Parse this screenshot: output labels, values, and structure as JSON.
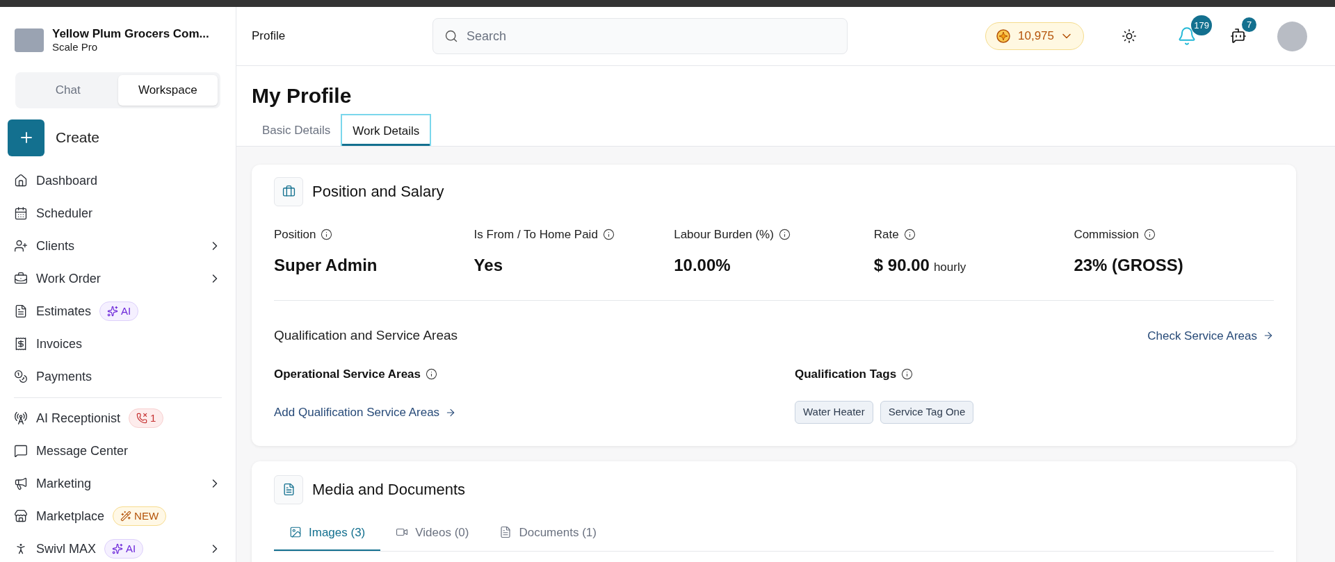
{
  "sidebar": {
    "company": {
      "name": "Yellow Plum Grocers Com...",
      "plan": "Scale Pro"
    },
    "mode_tabs": [
      {
        "label": "Chat",
        "selected": false
      },
      {
        "label": "Workspace",
        "selected": true
      }
    ],
    "create": {
      "label": "Create"
    },
    "sections": [
      {
        "items": [
          {
            "label": "Dashboard",
            "expandable": false
          },
          {
            "label": "Scheduler",
            "expandable": false
          },
          {
            "label": "Clients",
            "expandable": true
          },
          {
            "label": "Work Order",
            "expandable": true
          },
          {
            "label": "Estimates",
            "expandable": false,
            "badge": {
              "kind": "ai",
              "text": "AI"
            }
          },
          {
            "label": "Invoices",
            "expandable": false
          },
          {
            "label": "Payments",
            "expandable": false
          }
        ]
      },
      {
        "items": [
          {
            "label": "AI Receptionist",
            "expandable": false,
            "badge": {
              "kind": "missed",
              "text": "1"
            }
          },
          {
            "label": "Message Center",
            "expandable": false
          },
          {
            "label": "Marketing",
            "expandable": true
          },
          {
            "label": "Marketplace",
            "expandable": false,
            "badge": {
              "kind": "new",
              "text": "NEW"
            }
          },
          {
            "label": "Swivl MAX",
            "expandable": true,
            "badge": {
              "kind": "ai",
              "text": "AI"
            }
          }
        ]
      }
    ]
  },
  "header": {
    "breadcrumb": "Profile",
    "search": {
      "placeholder": "Search"
    },
    "coins": "10,975",
    "notifications": "179",
    "messages": "7"
  },
  "page": {
    "title": "My Profile",
    "tabs": [
      {
        "label": "Basic Details",
        "selected": false
      },
      {
        "label": "Work Details",
        "selected": true
      }
    ]
  },
  "position_card": {
    "title": "Position and Salary",
    "fields": [
      {
        "label": "Position",
        "value": "Super Admin"
      },
      {
        "label": "Is From / To Home Paid",
        "value": "Yes"
      },
      {
        "label": "Labour Burden (%)",
        "value": "10.00%"
      },
      {
        "label": "Rate",
        "value": "$ 90.00",
        "unit": "hourly"
      },
      {
        "label": "Commission",
        "value": "23% (GROSS)"
      }
    ],
    "section_title": "Qualification and Service Areas",
    "check_link": "Check Service Areas",
    "operational_label": "Operational Service Areas",
    "add_link": "Add Qualification Service Areas",
    "tags_label": "Qualification Tags",
    "tags": [
      "Water Heater",
      "Service Tag One"
    ]
  },
  "media_card": {
    "title": "Media and Documents",
    "tabs": [
      {
        "label": "Images (3)",
        "selected": true
      },
      {
        "label": "Videos (0)",
        "selected": false
      },
      {
        "label": "Documents (1)",
        "selected": false
      }
    ]
  }
}
